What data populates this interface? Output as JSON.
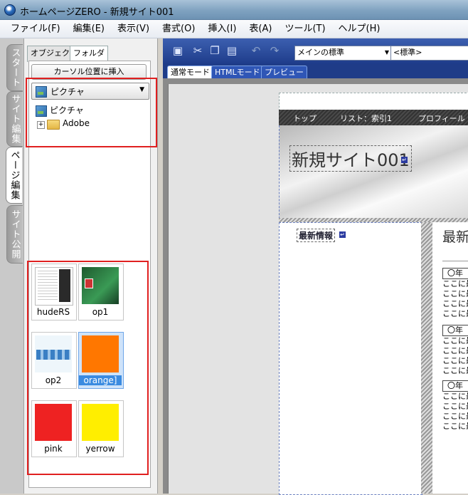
{
  "window": {
    "title": "ホームページZERO - 新規サイト001"
  },
  "menu": [
    "ファイル(F)",
    "編集(E)",
    "表示(V)",
    "書式(O)",
    "挿入(I)",
    "表(A)",
    "ツール(T)",
    "ヘルプ(H)"
  ],
  "side_tabs": [
    "スタート",
    "サイト編集",
    "ページ編集",
    "サイト公開"
  ],
  "panel": {
    "tabs": [
      "オブジェクト",
      "フォルダ"
    ],
    "insert_button": "カーソル位置に挿入",
    "folder_select": "ピクチャ",
    "tree": {
      "root": "ピクチャ",
      "child": "Adobe"
    },
    "thumbnails": [
      {
        "name": "hudeRS"
      },
      {
        "name": "op1"
      },
      {
        "name": "op2"
      },
      {
        "name": "orange]",
        "selected": true
      },
      {
        "name": "pink"
      },
      {
        "name": "yerrow"
      }
    ]
  },
  "toolbar": {
    "style_select": "メインの標準",
    "format_select": "<標準>"
  },
  "mode_tabs": [
    "通常モード",
    "HTMLモード",
    "プレビュー"
  ],
  "page": {
    "nav": [
      "トップ",
      "リスト：索引1",
      "プロフィール"
    ],
    "site_title": "新規サイト001",
    "side_heading": "最新情報",
    "main_heading": "最新",
    "entries": [
      {
        "date": "〇年",
        "lines": [
          "ここに最",
          "ここに最",
          "ここに最",
          "ここに最"
        ]
      },
      {
        "date": "〇年",
        "lines": [
          "ここに最",
          "ここに最",
          "ここに最",
          "ここに最"
        ]
      },
      {
        "date": "〇年",
        "lines": [
          "ここに最",
          "ここに最",
          "ここに最",
          "ここに最"
        ]
      }
    ]
  },
  "colors": {
    "title_bar": "#7fa2c0",
    "toolbar": "#1e3c8a",
    "highlight_box": "#e02020",
    "selection": "#3b8be0",
    "swatch_orange": "#ff7700",
    "swatch_pink": "#ee2222",
    "swatch_yellow": "#ffee00",
    "swatch_green": "#2d7a3c"
  }
}
